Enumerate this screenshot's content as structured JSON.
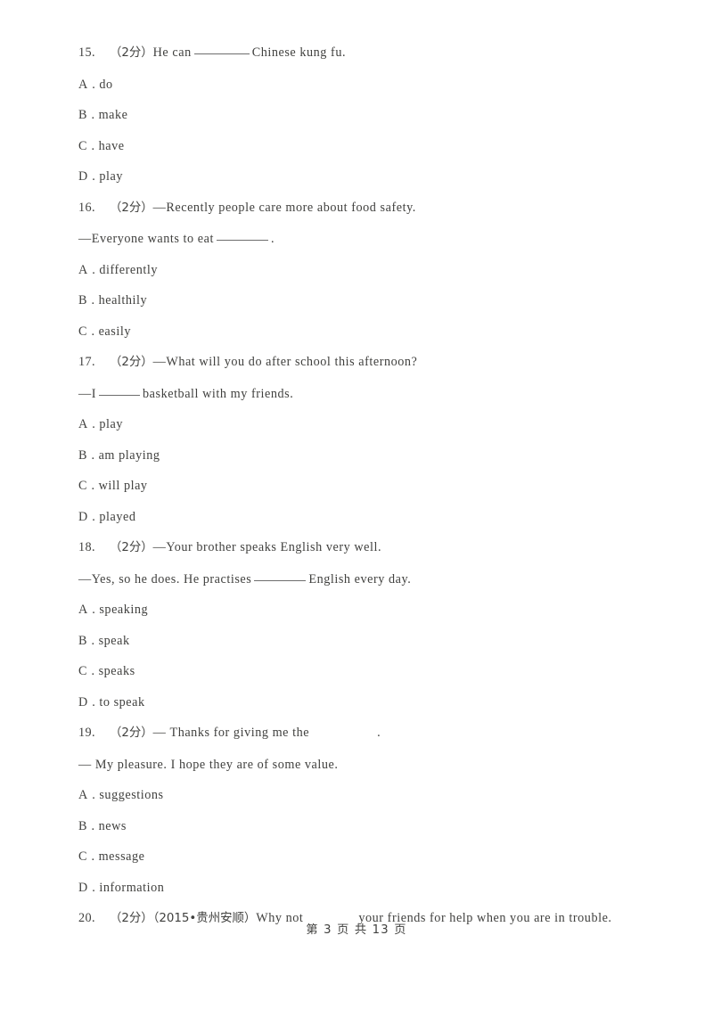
{
  "document": {
    "page_label": "第 3 页 共 13 页",
    "page_current": "3",
    "page_total": "13",
    "text_color": "#41413f",
    "background_color": "#ffffff"
  },
  "questions": [
    {
      "number": "15.",
      "score": "（2分）",
      "stem_before": "He can",
      "blank": "underline",
      "stem_after": "Chinese kung fu.",
      "second_line": null,
      "options": [
        {
          "letter": "A",
          "dot": ".",
          "text": "do"
        },
        {
          "letter": "B",
          "dot": ".",
          "text": "make"
        },
        {
          "letter": "C",
          "dot": ".",
          "text": "have"
        },
        {
          "letter": "D",
          "dot": ".",
          "text": "play"
        }
      ]
    },
    {
      "number": "16.",
      "score": "（2分）",
      "stem_before": "—Recently people care more about food safety.",
      "blank": "none",
      "stem_after": "",
      "second_line_before": "—Everyone wants to eat",
      "second_line_blank": "underline",
      "second_line_after": ".",
      "options": [
        {
          "letter": "A",
          "dot": ".",
          "text": "differently"
        },
        {
          "letter": "B",
          "dot": ".",
          "text": "healthily"
        },
        {
          "letter": "C",
          "dot": ".",
          "text": "easily"
        }
      ]
    },
    {
      "number": "17.",
      "score": "（2分）",
      "stem_before": "—What will you do after school this afternoon?",
      "blank": "none",
      "stem_after": "",
      "second_line_before": "—I",
      "second_line_blank": "underline",
      "second_line_after": "basketball with my friends.",
      "options": [
        {
          "letter": "A",
          "dot": ".",
          "text": "play"
        },
        {
          "letter": "B",
          "dot": ".",
          "text": "am playing"
        },
        {
          "letter": "C",
          "dot": ".",
          "text": "will play"
        },
        {
          "letter": "D",
          "dot": ".",
          "text": "played"
        }
      ]
    },
    {
      "number": "18.",
      "score": "（2分）",
      "stem_before": "—Your brother speaks English very well.",
      "blank": "none",
      "stem_after": "",
      "second_line_before": "—Yes, so he does. He practises",
      "second_line_blank": "underline",
      "second_line_after": "English every day.",
      "options": [
        {
          "letter": "A",
          "dot": ".",
          "text": "speaking"
        },
        {
          "letter": "B",
          "dot": ".",
          "text": "speak"
        },
        {
          "letter": "C",
          "dot": ".",
          "text": "speaks"
        },
        {
          "letter": "D",
          "dot": ".",
          "text": "to speak"
        }
      ]
    },
    {
      "number": "19.",
      "score": "（2分）",
      "stem_before": "— Thanks for giving me the",
      "blank": "whitespace",
      "stem_after": ".",
      "second_line_before": "— My pleasure. I hope they are of some value.",
      "second_line_blank": "none",
      "second_line_after": "",
      "options": [
        {
          "letter": "A",
          "dot": ".",
          "text": "suggestions"
        },
        {
          "letter": "B",
          "dot": ".",
          "text": "news"
        },
        {
          "letter": "C",
          "dot": ".",
          "text": "message"
        },
        {
          "letter": "D",
          "dot": ".",
          "text": "information"
        }
      ]
    },
    {
      "number": "20.",
      "score": "（2分）",
      "source": "（2015•贵州安顺）",
      "stem_before": "Why not",
      "blank": "whitespace",
      "stem_after": "your friends for help when you are in trouble.",
      "options": []
    }
  ]
}
